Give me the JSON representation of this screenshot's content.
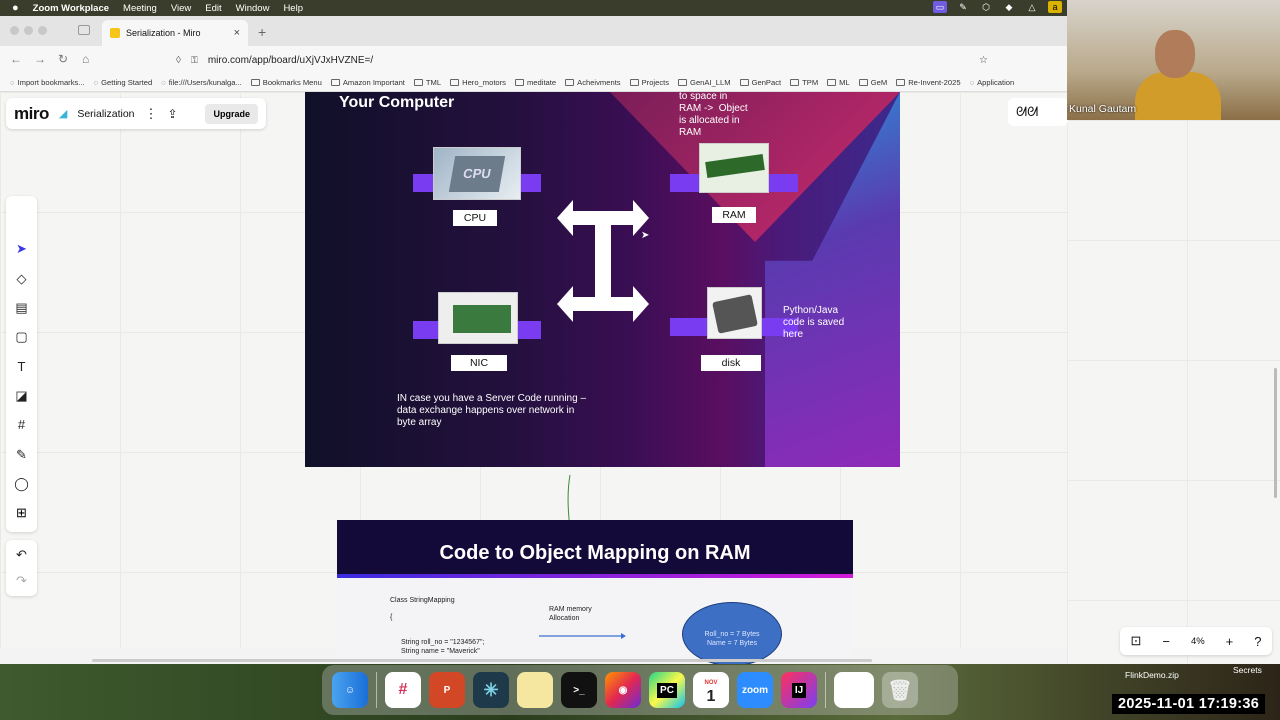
{
  "menubar": {
    "apple": "",
    "app_name": "Zoom Workplace",
    "items": [
      "Meeting",
      "View",
      "Edit",
      "Window",
      "Help"
    ]
  },
  "browser": {
    "tab_title": "Serialization - Miro",
    "tab_close": "×",
    "new_tab": "+",
    "url": "miro.com/app/board/uXjVJxHVZNE=/",
    "bookmarks": [
      {
        "label": "Import bookmarks...",
        "type": "icon"
      },
      {
        "label": "Getting Started",
        "type": "icon"
      },
      {
        "label": "file:///Users/kunalga...",
        "type": "icon"
      },
      {
        "label": "Bookmarks Menu",
        "type": "folder"
      },
      {
        "label": "Amazon Important",
        "type": "folder"
      },
      {
        "label": "TML",
        "type": "folder"
      },
      {
        "label": "Hero_motors",
        "type": "folder"
      },
      {
        "label": "meditate",
        "type": "folder"
      },
      {
        "label": "Acheivments",
        "type": "folder"
      },
      {
        "label": "Projects",
        "type": "folder"
      },
      {
        "label": "GenAI_LLM",
        "type": "folder"
      },
      {
        "label": "GenPact",
        "type": "folder"
      },
      {
        "label": "TPM",
        "type": "folder"
      },
      {
        "label": "ML",
        "type": "folder"
      },
      {
        "label": "GeM",
        "type": "folder"
      },
      {
        "label": "Re-Invent-2025",
        "type": "folder"
      },
      {
        "label": "Application",
        "type": "icon"
      }
    ]
  },
  "miro": {
    "logo": "miro",
    "board_title": "Serialization",
    "more_icon": "⋮",
    "share_icon": "⇪",
    "upgrade_label": "Upgrade",
    "zoom": "4%"
  },
  "slide1": {
    "title": "Your Computer",
    "labels": {
      "cpu": "CPU",
      "ram": "RAM",
      "nic": "NIC",
      "disk": "disk"
    },
    "ram_note": "to space in\nRAM ->  Object\nis allocated in\nRAM",
    "disk_note": "Python/Java\ncode is saved\nhere",
    "server_note": "IN case you have a Server Code running –\ndata exchange happens over network in\nbyte array"
  },
  "slide2": {
    "title": "Code to Object Mapping on RAM",
    "class_line": "Class StringMapping",
    "brace": "{",
    "code1": "String roll_no = \"1234567\";",
    "code2": "String name = \"Maverick\"",
    "alloc": "RAM memory\nAllocation",
    "ellipse1": "Roll_no = 7 Bytes",
    "ellipse2": "Name = 7 Bytes"
  },
  "webcam": {
    "name": "Kunal Gautam"
  },
  "desktop": {
    "file_label": "FlinkDemo.zip",
    "secrets_label": "Secrets",
    "clock": "2025-11-01  17:19:36",
    "calendar_month": "NOV",
    "calendar_day": "1",
    "zoom_label": "zoom",
    "ij_label": "IJ",
    "pc_label": "PC"
  }
}
